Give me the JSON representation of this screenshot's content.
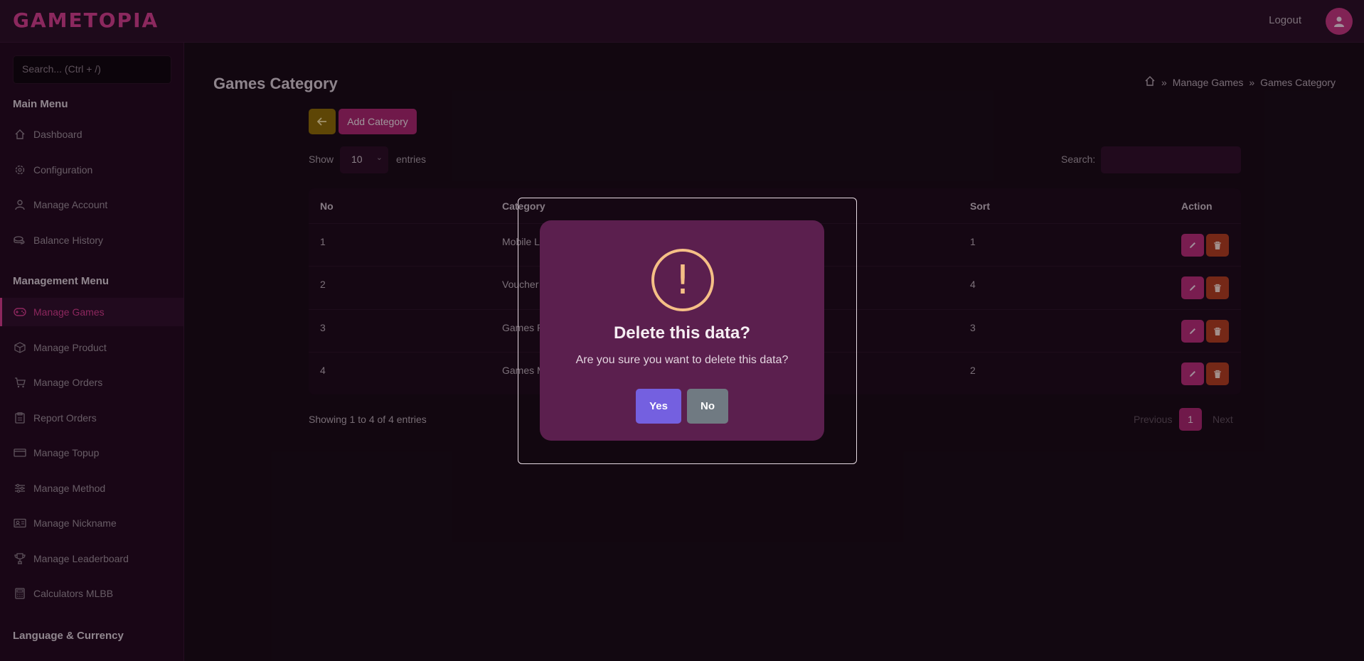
{
  "app": {
    "logo": "GAMETOPIA",
    "logout": "Logout"
  },
  "sidebar": {
    "search_placeholder": "Search... (Ctrl + /)",
    "main_menu": "Main Menu",
    "main_items": [
      {
        "label": "Dashboard",
        "icon": "home-icon"
      },
      {
        "label": "Configuration",
        "icon": "gear-icon"
      },
      {
        "label": "Manage Account",
        "icon": "user-icon"
      },
      {
        "label": "Balance History",
        "icon": "coins-icon"
      }
    ],
    "management_menu": "Management Menu",
    "management_items": [
      {
        "label": "Manage Games",
        "icon": "gamepad-icon",
        "active": true
      },
      {
        "label": "Manage Product",
        "icon": "box-icon"
      },
      {
        "label": "Manage Orders",
        "icon": "cart-icon"
      },
      {
        "label": "Report Orders",
        "icon": "clipboard-icon"
      },
      {
        "label": "Manage Topup",
        "icon": "card-icon"
      },
      {
        "label": "Manage Method",
        "icon": "sliders-icon"
      },
      {
        "label": "Manage Nickname",
        "icon": "id-card-icon"
      },
      {
        "label": "Manage Leaderboard",
        "icon": "trophy-icon"
      },
      {
        "label": "Calculators MLBB",
        "icon": "calculator-icon"
      }
    ],
    "language_currency": "Language & Currency"
  },
  "page": {
    "title": "Games Category",
    "breadcrumb": [
      "Manage Games",
      "Games Category"
    ],
    "add_button": "Add Category",
    "show_label": "Show",
    "entries_value": "10",
    "entries_label": "entries",
    "search_label": "Search:",
    "search_value": ""
  },
  "table": {
    "headers": [
      "No",
      "Category",
      "Sort",
      "Action"
    ],
    "rows": [
      {
        "no": "1",
        "category": "Mobile Le",
        "sort": "1"
      },
      {
        "no": "2",
        "category": "Voucher",
        "sort": "4"
      },
      {
        "no": "3",
        "category": "Games P",
        "sort": "3"
      },
      {
        "no": "4",
        "category": "Games M",
        "sort": "2"
      }
    ],
    "showing": "Showing 1 to 4 of 4 entries",
    "previous": "Previous",
    "page": "1",
    "next": "Next"
  },
  "modal": {
    "icon": "!",
    "title": "Delete this data?",
    "text": "Are you sure you want to delete this data?",
    "yes": "Yes",
    "no": "No"
  }
}
